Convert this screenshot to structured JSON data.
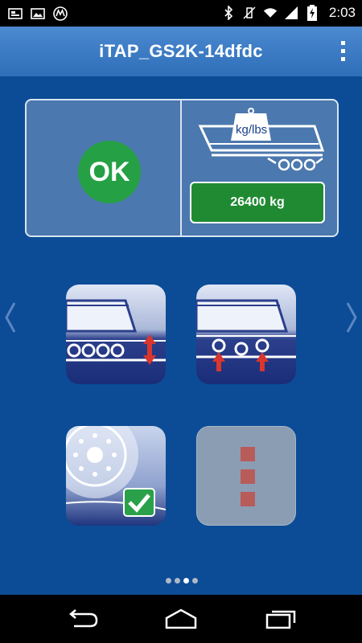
{
  "status_bar": {
    "time": "2:03",
    "icons": [
      "screenshot-icon",
      "image-icon",
      "motorola-icon",
      "bluetooth-icon",
      "vibrate-icon",
      "wifi-icon",
      "signal-icon",
      "battery-charging-icon"
    ]
  },
  "app_bar": {
    "title": "iTAP_GS2K-14dfdc",
    "menu_icon": "overflow-menu-icon"
  },
  "status_panel": {
    "ok_label": "OK",
    "weight_unit_label": "kg/lbs",
    "weight_value": "26400 kg",
    "colors": {
      "ok": "#25a045",
      "weight_button": "#1f8a32"
    }
  },
  "tiles": [
    {
      "name": "lower-suspension-tile",
      "icon": "truck-up-down-arrows-icon"
    },
    {
      "name": "raise-axle-tile",
      "icon": "truck-axle-lift-arrows-icon"
    },
    {
      "name": "tire-check-tile",
      "icon": "wheel-checkmark-icon"
    },
    {
      "name": "more-tile",
      "icon": "three-squares-icon"
    }
  ],
  "pager": {
    "pages": 4,
    "current": 3
  },
  "nav_bar": {
    "back": "back-icon",
    "home": "home-icon",
    "recents": "recents-icon"
  }
}
